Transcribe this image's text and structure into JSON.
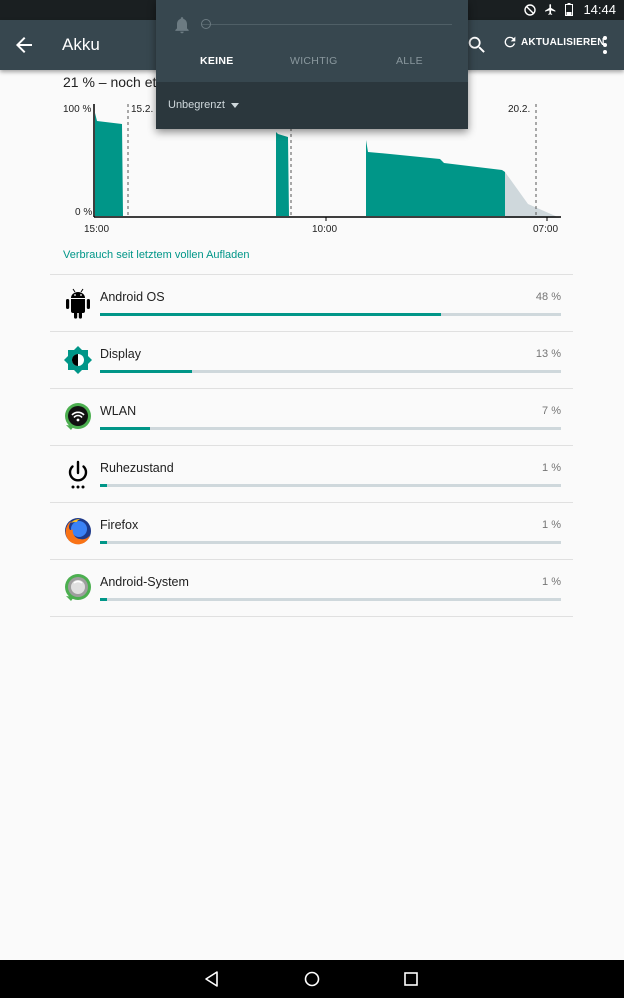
{
  "status": {
    "time": "14:44",
    "icons": [
      "do-not-disturb-icon",
      "airplane-icon",
      "battery-icon"
    ]
  },
  "appbar": {
    "title": "Akku",
    "refresh_label": "AKTUALISIEREN"
  },
  "summary": "21 % – noch et",
  "chart": {
    "y_top": "100 %",
    "y_bottom": "0 %",
    "date_markers": [
      "15.2.",
      "20.2."
    ],
    "x_ticks": [
      "15:00",
      "10:00",
      "07:00"
    ]
  },
  "link": "Verbrauch seit letztem vollen Aufladen",
  "apps": [
    {
      "name": "Android OS",
      "percent": "48 %",
      "usage": 0.48,
      "icon": "android-icon"
    },
    {
      "name": "Display",
      "percent": "13 %",
      "usage": 0.13,
      "icon": "brightness-icon"
    },
    {
      "name": "WLAN",
      "percent": "7 %",
      "usage": 0.07,
      "icon": "wifi-icon"
    },
    {
      "name": "Ruhezustand",
      "percent": "1 %",
      "usage": 0.01,
      "icon": "power-icon"
    },
    {
      "name": "Firefox",
      "percent": "1 %",
      "usage": 0.01,
      "icon": "firefox-icon"
    },
    {
      "name": "Android-System",
      "percent": "1 %",
      "usage": 0.01,
      "icon": "android-system-icon"
    }
  ],
  "dnd": {
    "tabs": [
      "KEINE",
      "WICHTIG",
      "ALLE"
    ],
    "selected_tab": "KEINE",
    "duration": "Unbegrenzt"
  },
  "colors": {
    "accent": "#009688",
    "appbar": "#37474f",
    "track": "#cfd8dc"
  }
}
